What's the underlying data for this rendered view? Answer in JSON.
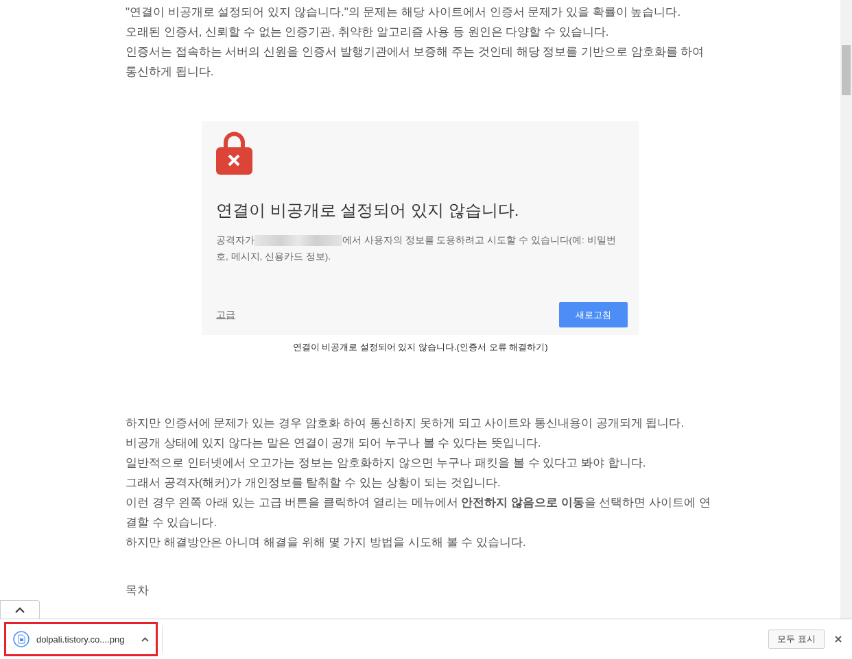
{
  "article": {
    "intro_lines": [
      "\"연결이 비공개로 설정되어 있지 않습니다.\"의 문제는 해당 사이트에서 인증서 문제가 있을 확률이 높습니다.",
      "오래된 인증서, 신뢰할 수 없는 인증기관, 취약한 알고리즘 사용 등 원인은 다양할 수 있습니다.",
      "인증서는 접속하는 서버의 신원을 인증서 발행기관에서 보증해 주는 것인데 해당 정보를 기반으로 암호화를 하여 통신하게 됩니다."
    ],
    "figure": {
      "title": "연결이 비공개로 설정되어 있지 않습니다.",
      "message_before": "공격자가",
      "message_after": "에서 사용자의 정보를 도용하려고 시도할 수 있습니다(예: 비밀번호, 메시지, 신용카드 정보).",
      "advanced_link": "고급",
      "reload_button": "새로고침",
      "caption": "연결이 비공개로 설정되어 있지 않습니다.(인증서 오류 해결하기)"
    },
    "body_lines": [
      "하지만 인증서에 문제가 있는 경우 암호화 하여 통신하지 못하게 되고 사이트와 통신내용이 공개되게 됩니다.",
      "비공개 상태에 있지 않다는 말은 연결이 공개 되어 누구나 볼 수 있다는 뜻입니다.",
      "일반적으로 인터넷에서 오고가는 정보는 암호화하지 않으면 누구나 패킷을 볼 수 있다고 봐야 합니다.",
      "그래서 공격자(해커)가 개인정보를 탈취할 수 있는 상황이 되는 것입니다.",
      "이런 경우 왼쪽 아래 있는 고급 버튼을 클릭하여 열리는 메뉴에서 **안전하지 않음으로 이동**을 선택하면 사이트에 연결할 수 있습니다.",
      "하지만 해결방안은 아니며 해결을 위해 몇 가지 방법을 시도해 볼 수 있습니다."
    ],
    "toc_heading": "목차"
  },
  "download_bar": {
    "items": [
      {
        "filename": "dolpali.tistory.co....png",
        "highlighted": true
      }
    ],
    "show_all_button": "모두 표시"
  }
}
